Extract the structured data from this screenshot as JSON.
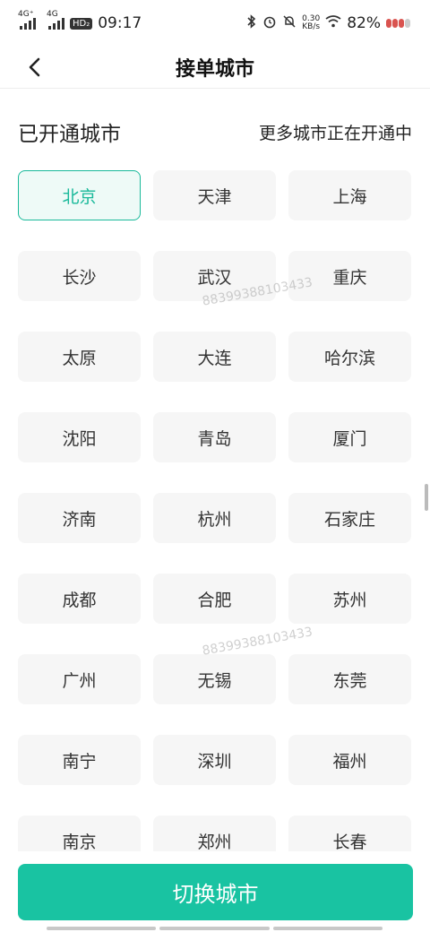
{
  "status_bar": {
    "net1": "4G⁺",
    "net2": "4G",
    "hd": "HD₂",
    "time": "09:17",
    "speed_value": "0.30",
    "speed_unit": "KB/s",
    "battery": "82%"
  },
  "header": {
    "title": "接单城市"
  },
  "section": {
    "title": "已开通城市",
    "subtitle": "更多城市正在开通中"
  },
  "cities": [
    {
      "name": "北京",
      "selected": true
    },
    {
      "name": "天津",
      "selected": false
    },
    {
      "name": "上海",
      "selected": false
    },
    {
      "name": "长沙",
      "selected": false
    },
    {
      "name": "武汉",
      "selected": false
    },
    {
      "name": "重庆",
      "selected": false
    },
    {
      "name": "太原",
      "selected": false
    },
    {
      "name": "大连",
      "selected": false
    },
    {
      "name": "哈尔滨",
      "selected": false
    },
    {
      "name": "沈阳",
      "selected": false
    },
    {
      "name": "青岛",
      "selected": false
    },
    {
      "name": "厦门",
      "selected": false
    },
    {
      "name": "济南",
      "selected": false
    },
    {
      "name": "杭州",
      "selected": false
    },
    {
      "name": "石家庄",
      "selected": false
    },
    {
      "name": "成都",
      "selected": false
    },
    {
      "name": "合肥",
      "selected": false
    },
    {
      "name": "苏州",
      "selected": false
    },
    {
      "name": "广州",
      "selected": false
    },
    {
      "name": "无锡",
      "selected": false
    },
    {
      "name": "东莞",
      "selected": false
    },
    {
      "name": "南宁",
      "selected": false
    },
    {
      "name": "深圳",
      "selected": false
    },
    {
      "name": "福州",
      "selected": false
    },
    {
      "name": "南京",
      "selected": false
    },
    {
      "name": "郑州",
      "selected": false
    },
    {
      "name": "长春",
      "selected": false
    }
  ],
  "watermark": "88399388103433",
  "button": {
    "label": "切换城市"
  },
  "colors": {
    "accent": "#19c3a2",
    "selected_border": "#19b99a",
    "selected_bg": "#eefaf7",
    "cell_bg": "#f6f6f6"
  }
}
